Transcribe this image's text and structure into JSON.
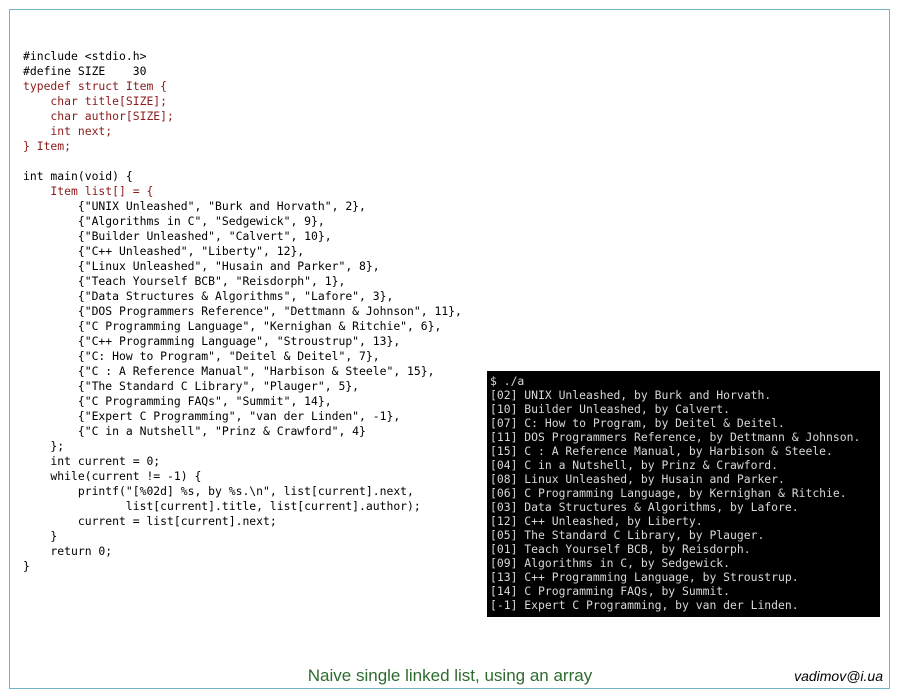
{
  "code": {
    "lines": [
      {
        "text": "",
        "red": false
      },
      {
        "text": "#include <stdio.h>",
        "red": false
      },
      {
        "text": "#define SIZE    30",
        "red": false
      },
      {
        "text": "typedef struct Item {",
        "red": true
      },
      {
        "text": "    char title[SIZE];",
        "red": true
      },
      {
        "text": "    char author[SIZE];",
        "red": true
      },
      {
        "text": "    int next;",
        "red": true
      },
      {
        "text": "} Item;",
        "red": true
      },
      {
        "text": "",
        "red": false
      },
      {
        "text": "int main(void) {",
        "red": false
      },
      {
        "text": "    Item list[] = {",
        "red": true
      },
      {
        "text": "        {\"UNIX Unleashed\", \"Burk and Horvath\", 2},",
        "red": false
      },
      {
        "text": "        {\"Algorithms in C\", \"Sedgewick\", 9},",
        "red": false
      },
      {
        "text": "        {\"Builder Unleashed\", \"Calvert\", 10},",
        "red": false
      },
      {
        "text": "        {\"C++ Unleashed\", \"Liberty\", 12},",
        "red": false
      },
      {
        "text": "        {\"Linux Unleashed\", \"Husain and Parker\", 8},",
        "red": false
      },
      {
        "text": "        {\"Teach Yourself BCB\", \"Reisdorph\", 1},",
        "red": false
      },
      {
        "text": "        {\"Data Structures & Algorithms\", \"Lafore\", 3},",
        "red": false
      },
      {
        "text": "        {\"DOS Programmers Reference\", \"Dettmann & Johnson\", 11},",
        "red": false
      },
      {
        "text": "        {\"C Programming Language\", \"Kernighan & Ritchie\", 6},",
        "red": false
      },
      {
        "text": "        {\"C++ Programming Language\", \"Stroustrup\", 13},",
        "red": false
      },
      {
        "text": "        {\"C: How to Program\", \"Deitel & Deitel\", 7},",
        "red": false
      },
      {
        "text": "        {\"C : A Reference Manual\", \"Harbison & Steele\", 15},",
        "red": false
      },
      {
        "text": "        {\"The Standard C Library\", \"Plauger\", 5},",
        "red": false
      },
      {
        "text": "        {\"C Programming FAQs\", \"Summit\", 14},",
        "red": false
      },
      {
        "text": "        {\"Expert C Programming\", \"van der Linden\", -1},",
        "red": false
      },
      {
        "text": "        {\"C in a Nutshell\", \"Prinz & Crawford\", 4}",
        "red": false
      },
      {
        "text": "    };",
        "red": false
      },
      {
        "text": "    int current = 0;",
        "red": false
      },
      {
        "text": "    while(current != -1) {",
        "red": false
      },
      {
        "text": "        printf(\"[%02d] %s, by %s.\\n\", list[current].next,",
        "red": false
      },
      {
        "text": "               list[current].title, list[current].author);",
        "red": false
      },
      {
        "text": "        current = list[current].next;",
        "red": false
      },
      {
        "text": "    }",
        "red": false
      },
      {
        "text": "    return 0;",
        "red": false
      },
      {
        "text": "}",
        "red": false
      }
    ]
  },
  "terminal": {
    "lines": [
      "$ ./a",
      "[02] UNIX Unleashed, by Burk and Horvath.",
      "[10] Builder Unleashed, by Calvert.",
      "[07] C: How to Program, by Deitel & Deitel.",
      "[11] DOS Programmers Reference, by Dettmann & Johnson.",
      "[15] C : A Reference Manual, by Harbison & Steele.",
      "[04] C in a Nutshell, by Prinz & Crawford.",
      "[08] Linux Unleashed, by Husain and Parker.",
      "[06] C Programming Language, by Kernighan & Ritchie.",
      "[03] Data Structures & Algorithms, by Lafore.",
      "[12] C++ Unleashed, by Liberty.",
      "[05] The Standard C Library, by Plauger.",
      "[01] Teach Yourself BCB, by Reisdorph.",
      "[09] Algorithms in C, by Sedgewick.",
      "[13] C++ Programming Language, by Stroustrup.",
      "[14] C Programming FAQs, by Summit.",
      "[-1] Expert C Programming, by van der Linden."
    ]
  },
  "caption": "Naive single linked list, using an array",
  "author": "vadimov@i.ua",
  "colors": {
    "border": "#6fb6c9",
    "code_text": "#000000",
    "code_keyword_red": "#8b1a1a",
    "terminal_bg": "#000000",
    "terminal_text": "#d8d8d8",
    "caption": "#2e6b2e"
  }
}
